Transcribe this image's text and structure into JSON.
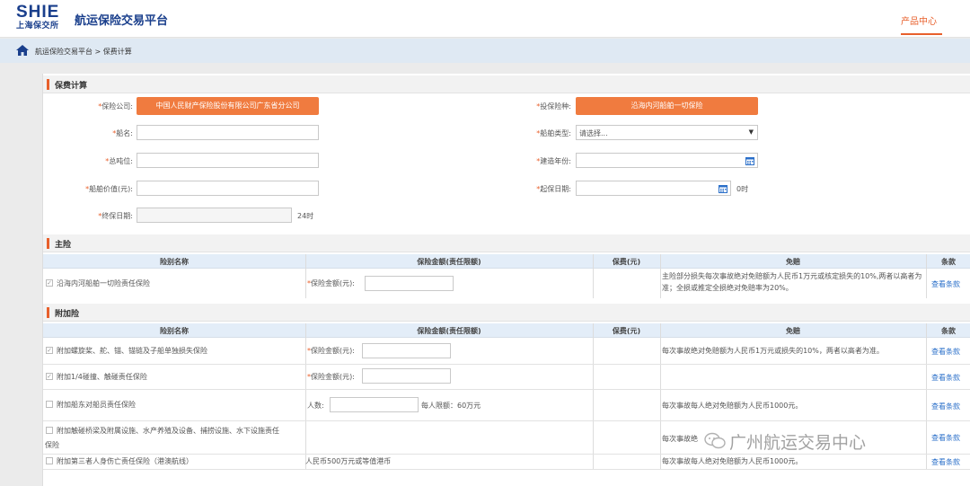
{
  "header": {
    "logo_main": "SHIE",
    "logo_sub": "上海保交所",
    "site_title": "航运保险交易平台",
    "nav_product": "产品中心"
  },
  "breadcrumb": {
    "text": "航运保险交易平台 > 保费计算"
  },
  "calc": {
    "section_title": "保费计算",
    "insurer_label": "保险公司:",
    "insurer_value": "中国人民财产保险股份有限公司广东省分公司",
    "product_label": "投保险种:",
    "product_value": "沿海内河船舶一切保险",
    "ship_name_label": "船名:",
    "ship_type_label": "船舶类型:",
    "ship_type_placeholder": "请选择...",
    "tonnage_label": "总吨位:",
    "build_year_label": "建造年份:",
    "ship_value_label": "船舶价值(元):",
    "start_date_label": "起保日期:",
    "start_suffix": "0时",
    "end_date_label": "终保日期:",
    "end_suffix": "24时"
  },
  "main_risk": {
    "section_title": "主险",
    "headers": [
      "险别名称",
      "保险金额(责任限额)",
      "保费(元)",
      "免赔",
      "条款"
    ],
    "row": {
      "name": "沿海内河船舶一切险责任保险",
      "amount_label": "保险金额(元):",
      "deductible": "主险部分损失每次事故绝对免赔额为人民币1万元或核定损失的10%,两者以高者为准；全损或推定全损绝对免赔率为20%。",
      "link": "查看条款"
    }
  },
  "addon": {
    "section_title": "附加险",
    "headers": [
      "险别名称",
      "保险金额(责任限额)",
      "保费(元)",
      "免赔",
      "条款"
    ],
    "rows": [
      {
        "name": "附加螺旋桨、舵、锚、锚链及子船单独损失保险",
        "amount_label": "保险金额(元):",
        "deductible": "每次事故绝对免赔额为人民币1万元或损失的10%，两者以高者为准。",
        "link": "查看条款"
      },
      {
        "name": "附加1/4碰撞、触碰责任保险",
        "amount_label": "保险金额(元):",
        "deductible": "",
        "link": "查看条款"
      },
      {
        "name": "附加船东对船员责任保险",
        "amount_label": "人数:",
        "limit_text": "每人限额：60万元",
        "deductible": "每次事故每人绝对免赔额为人民币1000元。",
        "link": "查看条款"
      },
      {
        "name_line1": "附加触碰桥梁及附属设施、水产养殖及设备、捕捞设施、水下设施责任",
        "name_line2": "保险",
        "deductible": "每次事故绝",
        "link": "查看条款"
      },
      {
        "name": "附加第三者人身伤亡责任保险（港澳航线）",
        "amount_text": "人民币500万元或等值港币",
        "deductible": "每次事故每人绝对免赔额为人民币1000元。",
        "link": "查看条款"
      }
    ]
  },
  "watermark": {
    "text": "广州航运交易中心"
  },
  "colors": {
    "accent": "#f07b3f",
    "brand": "#1a3f8c",
    "link": "#2a6fc9"
  }
}
